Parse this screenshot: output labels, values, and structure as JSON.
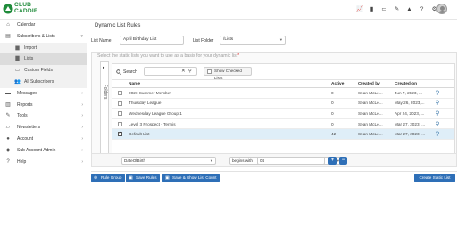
{
  "brand": {
    "line1": "CLUB",
    "line2": "CADDIE",
    "color": "#1f8b3a"
  },
  "topbar": {
    "icons": [
      "chart-icon",
      "document-icon",
      "clipboard-icon",
      "edit-icon",
      "alert-icon",
      "help-icon",
      "gear-icon"
    ],
    "glyphs": [
      "📈",
      "▮",
      "▭",
      "✎",
      "▲",
      "?",
      "⚙"
    ]
  },
  "sidebar": {
    "items": [
      {
        "label": "Calendar",
        "icon": "⌂"
      },
      {
        "label": "Subscribers & Lists",
        "icon": "▤",
        "expanded": true
      },
      {
        "label": "Messages",
        "icon": "▬"
      },
      {
        "label": "Reports",
        "icon": "▥"
      },
      {
        "label": "Tools",
        "icon": "✎"
      },
      {
        "label": "Newsletters",
        "icon": "▱"
      },
      {
        "label": "Account",
        "icon": "●"
      },
      {
        "label": "Sub Account Admin",
        "icon": "◆"
      },
      {
        "label": "Help",
        "icon": "?"
      }
    ],
    "sub_items": [
      {
        "label": "Import",
        "icon": "▆"
      },
      {
        "label": "Lists",
        "icon": "▇",
        "active": true
      },
      {
        "label": "Custom Fields",
        "icon": "▭"
      },
      {
        "label": "All Subscribers",
        "icon": "👥"
      }
    ]
  },
  "page": {
    "title": "Dynamic List Rules",
    "list_name_label": "List Name",
    "list_name_value": "April Birthday List",
    "list_folder_label": "List Folder",
    "list_folder_value": "/Lists",
    "panel_heading": "Select the static lists you want to use as a basis for your dynamic list",
    "required_mark": "*",
    "folders_label": "Folders",
    "search_label": "Search",
    "show_checked_label": "Show Checked Lists"
  },
  "table": {
    "columns": [
      "Name",
      "Active",
      "Created by",
      "Created on"
    ],
    "rows": [
      {
        "name": "2023 Summer Member",
        "active": "0",
        "created_by": "Sean McLe...",
        "created_on": "Jun 7, 2023, ...",
        "checked": false
      },
      {
        "name": "Thursday League",
        "active": "0",
        "created_by": "Sean McLe...",
        "created_on": "May 26, 2023,...",
        "checked": false
      },
      {
        "name": "Wednesday League Group 1",
        "active": "0",
        "created_by": "Sean McLe...",
        "created_on": "Apr 24, 2023, ...",
        "checked": false
      },
      {
        "name": "Level 3 Prospect - Tennis",
        "active": "0",
        "created_by": "Sean McLe...",
        "created_on": "Mar 27, 2023, ...",
        "checked": false
      },
      {
        "name": "Default List",
        "active": "42",
        "created_by": "Sean McLe...",
        "created_on": "Mar 27, 2023, ...",
        "checked": true
      }
    ]
  },
  "filter": {
    "field_value": "DateOfBirth",
    "operator_value": "begins with",
    "value": "04"
  },
  "buttons": {
    "rule_group": "Rule Group",
    "save_rules": "Save Rules",
    "save_show": "Save & Show List Count",
    "create_static": "Create Static List"
  },
  "colors": {
    "primary": "#2e6fb7",
    "selected_row": "#dfeef8"
  }
}
